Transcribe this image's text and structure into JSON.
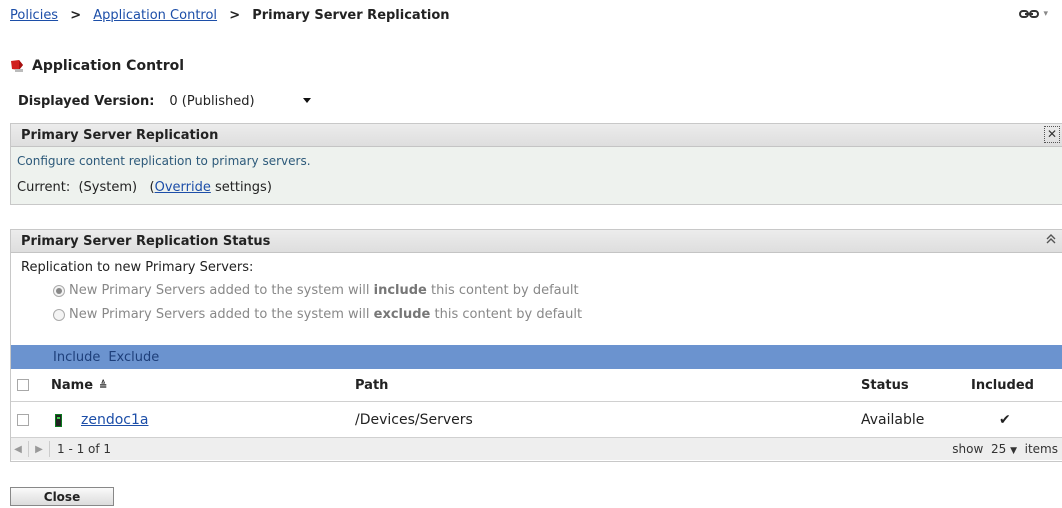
{
  "breadcrumb": {
    "items": [
      "Policies",
      "Application Control"
    ],
    "separator": ">",
    "current": "Primary Server Replication"
  },
  "header_tools": {
    "icon": "link-icon",
    "dropdown": "▾"
  },
  "page": {
    "title": "Application Control",
    "icon": "application-control-icon",
    "version_label": "Displayed Version:",
    "version_value": "0 (Published)"
  },
  "replication_panel": {
    "title": "Primary Server Replication",
    "close_label": "✕",
    "description": "Configure content replication to primary servers.",
    "current_label": "Current:",
    "current_value": "(System)",
    "override_open": "(",
    "override_link": "Override",
    "override_rest": " settings)"
  },
  "status_panel": {
    "title": "Primary Server Replication Status",
    "collapse_label": "≈",
    "repl_label": "Replication to new Primary Servers:",
    "option_include": {
      "prefix": "New Primary Servers added to the system will ",
      "bold": "include",
      "suffix": " this content by default",
      "selected": true
    },
    "option_exclude": {
      "prefix": "New Primary Servers added to the system will ",
      "bold": "exclude",
      "suffix": " this content by default",
      "selected": false
    },
    "actions": [
      "Include",
      "Exclude"
    ],
    "columns": [
      "Name",
      "Path",
      "Status",
      "Included"
    ],
    "sort_glyph": "≜",
    "rows": [
      {
        "name": "zendoc1a",
        "path": "/Devices/Servers",
        "status": "Available",
        "included": "✔"
      }
    ],
    "pager": {
      "prev": "◀",
      "next": "▶",
      "range": "1 - 1 of 1",
      "show_label": "show",
      "page_size": "25",
      "items_label": "items"
    }
  },
  "footer": {
    "close_label": "Close"
  },
  "colors": {
    "link": "#1c4ea8",
    "action_bar": "#6b93cf",
    "panel_bg": "#eef2ee"
  }
}
